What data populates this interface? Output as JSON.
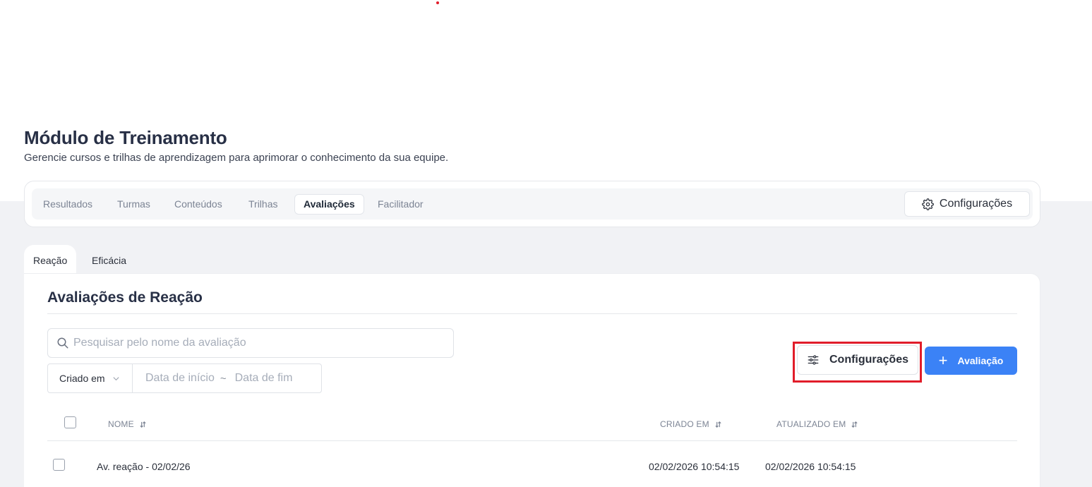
{
  "page": {
    "title": "Módulo de Treinamento",
    "subtitle": "Gerencie cursos e trilhas de aprendizagem para aprimorar o conhecimento da sua equipe."
  },
  "nav": {
    "tabs": [
      {
        "label": "Resultados",
        "active": false
      },
      {
        "label": "Turmas",
        "active": false
      },
      {
        "label": "Conteúdos",
        "active": false
      },
      {
        "label": "Trilhas",
        "active": false
      },
      {
        "label": "Avaliações",
        "active": true
      },
      {
        "label": "Facilitador",
        "active": false
      }
    ],
    "config_label": "Configurações",
    "config_icon": "gear-icon"
  },
  "subtabs": [
    {
      "label": "Reação",
      "active": true
    },
    {
      "label": "Eficácia",
      "active": false
    }
  ],
  "section": {
    "title": "Avaliações de Reação"
  },
  "filters": {
    "search_placeholder": "Pesquisar pelo nome da avaliação",
    "search_icon": "search-icon",
    "date_field": "Criado em",
    "start_placeholder": "Data de início",
    "separator": "~",
    "end_placeholder": "Data de fim"
  },
  "actions": {
    "config_label": "Configurações",
    "config_icon": "sliders-icon",
    "highlight_color": "#e11d2a",
    "add_label": "Avaliação",
    "add_icon": "plus-icon",
    "primary_color": "#3b82f6"
  },
  "table": {
    "columns": {
      "name": "NOME",
      "created": "CRIADO EM",
      "updated": "ATUALIZADO EM"
    },
    "rows": [
      {
        "name": "Av. reação - 02/02/26",
        "created": "02/02/2026 10:54:15",
        "updated": "02/02/2026 10:54:15"
      }
    ]
  }
}
